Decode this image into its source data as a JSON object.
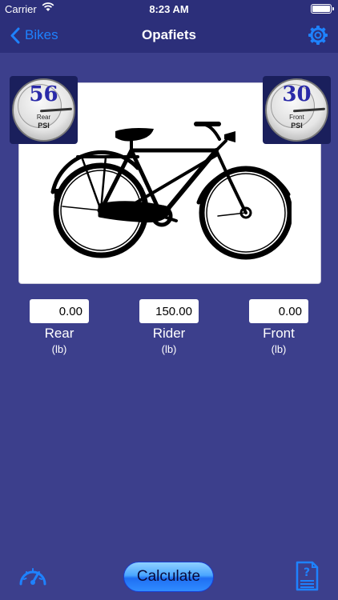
{
  "status_bar": {
    "carrier": "Carrier",
    "time": "8:23 AM"
  },
  "nav": {
    "back_label": "Bikes",
    "title": "Opafiets"
  },
  "gauges": {
    "rear": {
      "value": "56",
      "label": "Rear",
      "unit": "PSI"
    },
    "front": {
      "value": "30",
      "label": "Front",
      "unit": "PSI"
    }
  },
  "weights": {
    "rear": {
      "value": "0.00",
      "label": "Rear",
      "unit": "(lb)"
    },
    "rider": {
      "value": "150.00",
      "label": "Rider",
      "unit": "(lb)"
    },
    "front": {
      "value": "0.00",
      "label": "Front",
      "unit": "(lb)"
    }
  },
  "toolbar": {
    "calculate_label": "Calculate"
  },
  "icons": {
    "back": "chevron-left-icon",
    "settings": "gear-icon",
    "wifi": "wifi-icon",
    "battery": "battery-icon",
    "pressure": "speedometer-icon",
    "help": "help-document-icon"
  },
  "colors": {
    "background": "#3c3f8c",
    "nav_background": "#2c2f7a",
    "accent": "#1e82ff",
    "gauge_value": "#2a2aa8"
  }
}
